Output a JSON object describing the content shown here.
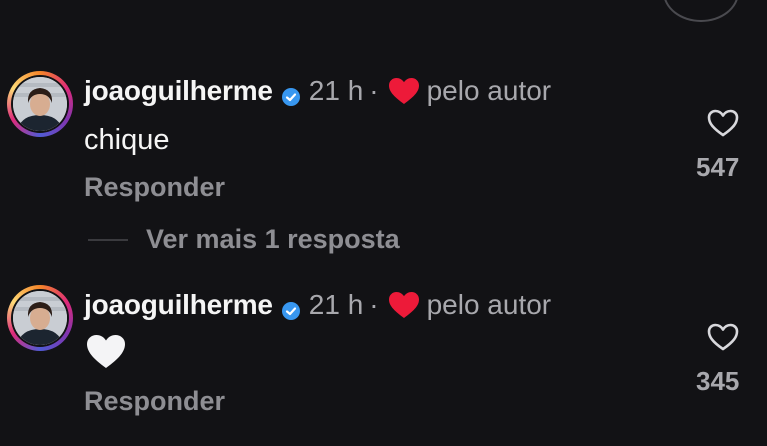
{
  "comments": [
    {
      "username": "joaoguilherme",
      "time": "21 h",
      "separator": "·",
      "liked_by_author": "pelo autor",
      "text": "chique",
      "reply_label": "Responder",
      "likes": "547",
      "icons": {
        "verified": "verified-badge-icon",
        "author_like": "heart-red-icon",
        "like": "heart-outline-icon"
      }
    },
    {
      "username": "joaoguilherme",
      "time": "21 h",
      "separator": "·",
      "liked_by_author": "pelo autor",
      "text_emoji": "white-heart-emoji",
      "reply_label": "Responder",
      "likes": "345",
      "icons": {
        "verified": "verified-badge-icon",
        "author_like": "heart-red-icon",
        "like": "heart-outline-icon"
      }
    }
  ],
  "more_replies": "Ver mais 1 resposta",
  "colors": {
    "background": "#121215",
    "text_primary": "#f5f5f5",
    "text_secondary": "#a8a8ad",
    "verified_blue": "#3897f0",
    "heart_red": "#ed1a39"
  }
}
